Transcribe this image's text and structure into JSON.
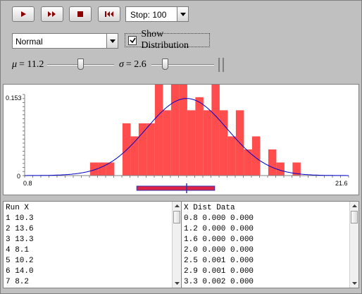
{
  "controls": {
    "stop_label": "Stop: 100",
    "distribution": "Normal",
    "show_distribution_label": "Show Distribution",
    "show_distribution_checked": true,
    "mu": {
      "symbol": "μ",
      "text": "= 11.2",
      "value": 11.2,
      "min": 0.8,
      "max": 21.6
    },
    "sigma": {
      "symbol": "σ",
      "text": "= 2.6",
      "value": 2.6,
      "min": 0.5,
      "max": 12
    }
  },
  "colors": {
    "button_icon": "#8b0000",
    "bars": "#ff4d4d",
    "density": "#0000cc",
    "box": "#dd2244",
    "box_outline": "#3333aa"
  },
  "chart_data": {
    "type": "bar",
    "x_min": 0.8,
    "x_max": 21.6,
    "y_max": 0.153,
    "tick_labels": {
      "x_left": "0.8",
      "x_right": "21.6",
      "y_top": "0.153",
      "y_zero": "0"
    },
    "bin_width": 0.52,
    "bars": [
      {
        "x": 5.0,
        "h": 0.026
      },
      {
        "x": 5.52,
        "h": 0.026
      },
      {
        "x": 6.04,
        "h": 0.026
      },
      {
        "x": 7.08,
        "h": 0.104
      },
      {
        "x": 7.6,
        "h": 0.078
      },
      {
        "x": 8.12,
        "h": 0.104
      },
      {
        "x": 8.64,
        "h": 0.104
      },
      {
        "x": 9.16,
        "h": 0.182
      },
      {
        "x": 9.68,
        "h": 0.13
      },
      {
        "x": 10.2,
        "h": 0.182
      },
      {
        "x": 10.72,
        "h": 0.208
      },
      {
        "x": 11.24,
        "h": 0.13
      },
      {
        "x": 11.76,
        "h": 0.156
      },
      {
        "x": 12.28,
        "h": 0.13
      },
      {
        "x": 12.8,
        "h": 0.182
      },
      {
        "x": 13.32,
        "h": 0.13
      },
      {
        "x": 13.84,
        "h": 0.078
      },
      {
        "x": 14.36,
        "h": 0.13
      },
      {
        "x": 14.88,
        "h": 0.052
      },
      {
        "x": 15.4,
        "h": 0.078
      },
      {
        "x": 16.44,
        "h": 0.052
      },
      {
        "x": 16.96,
        "h": 0.026
      },
      {
        "x": 18.0,
        "h": 0.026
      }
    ],
    "density": {
      "mean": 11.2,
      "sd": 2.6
    },
    "box": {
      "q_low": 8.0,
      "q_high": 13.0,
      "mean": 11.2
    }
  },
  "run_table": {
    "header": "Run X",
    "rows": [
      "1 10.3",
      "2 13.6",
      "3 13.3",
      "4 8.1",
      "5 10.2",
      "6 14.0",
      "7 8.2"
    ]
  },
  "dist_table": {
    "header": "X Dist Data",
    "rows": [
      "0.8 0.000 0.000",
      "1.2 0.000 0.000",
      "1.6 0.000 0.000",
      "2.0 0.000 0.000",
      "2.5 0.001 0.000",
      "2.9 0.001 0.000",
      "3.3 0.002 0.000"
    ]
  }
}
